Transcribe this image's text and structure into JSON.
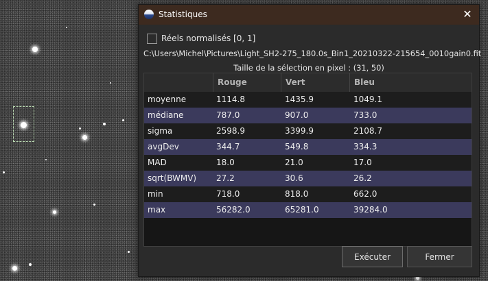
{
  "window": {
    "title": "Statistiques",
    "close_glyph": "✕"
  },
  "options": {
    "normalized_label": "Réels normalisés [0, 1]",
    "normalized_checked": false
  },
  "file_path": "C:\\Users\\Michel\\Pictures\\Light_SH2-275_180.0s_Bin1_20210322-215654_0010gain0.fit",
  "selection_size": "Taille de la sélection en pixel : (31, 50)",
  "table": {
    "columns": [
      "",
      "Rouge",
      "Vert",
      "Bleu"
    ],
    "rows": [
      {
        "name": "moyenne",
        "rouge": "1114.8",
        "vert": "1435.9",
        "bleu": "1049.1"
      },
      {
        "name": "médiane",
        "rouge": "787.0",
        "vert": "907.0",
        "bleu": "733.0"
      },
      {
        "name": "sigma",
        "rouge": "2598.9",
        "vert": "3399.9",
        "bleu": "2108.7"
      },
      {
        "name": "avgDev",
        "rouge": "344.7",
        "vert": "549.8",
        "bleu": "334.3"
      },
      {
        "name": "MAD",
        "rouge": "18.0",
        "vert": "21.0",
        "bleu": "17.0"
      },
      {
        "name": "sqrt(BWMV)",
        "rouge": "27.2",
        "vert": "30.6",
        "bleu": "26.2"
      },
      {
        "name": "min",
        "rouge": "718.0",
        "vert": "818.0",
        "bleu": "662.0"
      },
      {
        "name": "max",
        "rouge": "56282.0",
        "vert": "65281.0",
        "bleu": "39284.0"
      }
    ]
  },
  "buttons": {
    "run": "Exécuter",
    "close": "Fermer"
  },
  "colors": {
    "titlebar": "#3d2a1f",
    "row_alt": "#3b3a5c",
    "row": "#1d1d1d",
    "dialog": "#2b2b2b"
  }
}
